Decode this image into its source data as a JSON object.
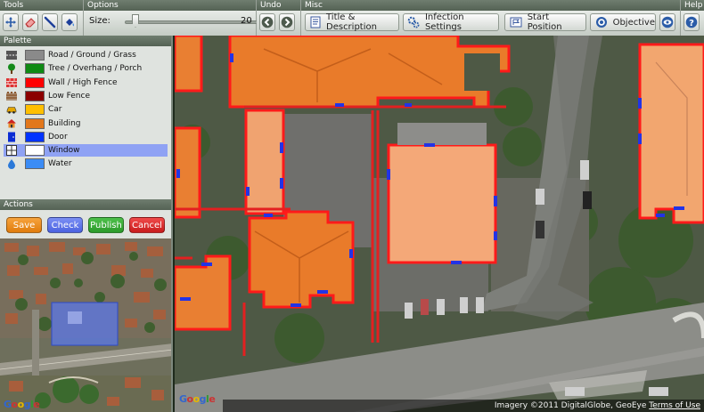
{
  "toolbar": {
    "groups": {
      "tools": "Tools",
      "options": "Options",
      "undo": "Undo",
      "misc": "Misc",
      "help": "Help"
    },
    "options": {
      "size_label": "Size:",
      "size_value": "20"
    },
    "misc_buttons": {
      "title_desc": "Title & Description",
      "infection": "Infection Settings",
      "start_position": "Start Position",
      "objective": "Objective"
    }
  },
  "palette": {
    "title": "Palette",
    "selected_index": 8,
    "items": [
      {
        "label": "Road / Ground / Grass",
        "color": "#8a8a8a",
        "icon": "road-icon"
      },
      {
        "label": "Tree / Overhang / Porch",
        "color": "#0f8a14",
        "icon": "tree-icon"
      },
      {
        "label": "Wall / High Fence",
        "color": "#ff0000",
        "icon": "brick-wall-icon"
      },
      {
        "label": "Low Fence",
        "color": "#8b0000",
        "icon": "fence-icon"
      },
      {
        "label": "Car",
        "color": "#ffbf00",
        "icon": "car-icon"
      },
      {
        "label": "Building",
        "color": "#e2771b",
        "icon": "house-icon"
      },
      {
        "label": "Door",
        "color": "#0033ff",
        "icon": "door-icon"
      },
      {
        "label": "Window",
        "color": "#ffffff",
        "icon": "window-icon"
      },
      {
        "label": "Water",
        "color": "#3b8cf5",
        "icon": "water-icon"
      }
    ]
  },
  "actions": {
    "title": "Actions",
    "save": "Save",
    "check": "Check",
    "publish": "Publish",
    "cancel": "Cancel"
  },
  "map": {
    "attribution": "Imagery ©2011 DigitalGlobe, GeoEye",
    "terms": "Terms of Use",
    "logo": "Google"
  },
  "minimap": {
    "logo": "Google"
  }
}
